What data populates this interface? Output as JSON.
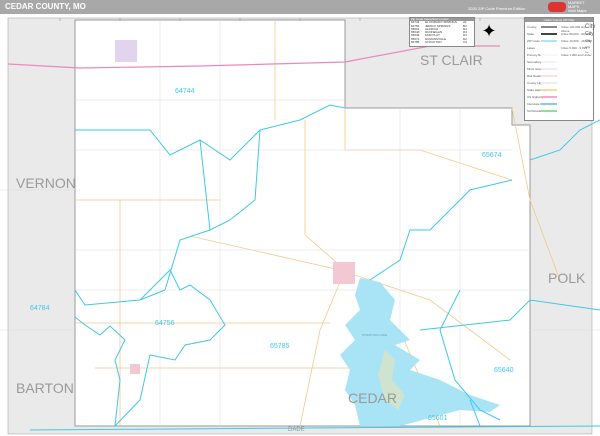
{
  "header": {
    "title": "CEDAR COUNTY, MO",
    "edition": "2020 ZIP Code Premium Edition",
    "logo_text": [
      "MARKET",
      "MAPS",
      "Wall Maps"
    ]
  },
  "zip_table": {
    "title": "Zip Code Index/Grid Locator",
    "rows": [
      {
        "zip": "64744",
        "city": "EL DORADO SPRINGS",
        "grid": "A1"
      },
      {
        "zip": "64756",
        "city": "JERICO SPRINGS",
        "grid": "B3"
      },
      {
        "zip": "65601",
        "city": "ALDRICH",
        "grid": "D4"
      },
      {
        "zip": "65640",
        "city": "DUNNEGAN",
        "grid": "D4"
      },
      {
        "zip": "65649",
        "city": "FAIR PLAY",
        "grid": "D4"
      },
      {
        "zip": "65674",
        "city": "HUMANSVILLE",
        "grid": "D2"
      },
      {
        "zip": "65785",
        "city": "STOCKTON",
        "grid": "C3"
      }
    ]
  },
  "legend": {
    "title": "Cedar County ZIP Map",
    "items": [
      "County",
      "State",
      "ZIP Code",
      "Lakes",
      "Primary Roads",
      "Secondary Roads",
      "Minor Roads",
      "Rail Roads",
      "County Highways",
      "State Highways",
      "US Highways",
      "Interstate Highways",
      "Toll Roads"
    ],
    "city_sizes": [
      "Cities 100,000 and Above",
      "Cities 50,000 - 99,999",
      "Cities 10,000 - 49,999",
      "Cities 5,000 - 9,999",
      "Cities 1,000 and Under"
    ],
    "city_word": "City"
  },
  "map": {
    "county_name": "CEDAR",
    "neighbors": [
      "ST CLAIR",
      "VERNON",
      "POLK",
      "BARTON",
      "DADE"
    ],
    "zips": [
      "64744",
      "65674",
      "64784",
      "64756",
      "65785",
      "65640",
      "65601"
    ],
    "lake_label": "STOCKTON LAKE",
    "colors": {
      "zip": "#3fc8e6",
      "lake": "#a8e4f6",
      "city": "#f2c9d3",
      "road": "#f5c88a",
      "highway": "#e88ac0",
      "outside": "#eaeaea"
    }
  }
}
